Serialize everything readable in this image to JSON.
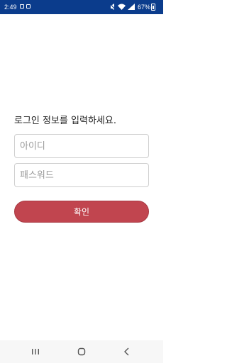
{
  "status_bar": {
    "time": "2:49",
    "battery": "67%",
    "icons": [
      "notification-icon",
      "image-icon",
      "silent-icon",
      "wifi-icon",
      "signal-icon",
      "battery-icon"
    ]
  },
  "login": {
    "prompt": "로그인 정보를 입력하세요.",
    "id_placeholder": "아이디",
    "password_placeholder": "패스워드",
    "confirm_label": "확인"
  },
  "nav_bar": {
    "buttons": [
      "recent-apps-icon",
      "home-icon",
      "back-icon"
    ]
  },
  "colors": {
    "status_bar": "#0b3c8c",
    "accent": "#c1454f",
    "nav_bar": "#f7f7f7"
  }
}
